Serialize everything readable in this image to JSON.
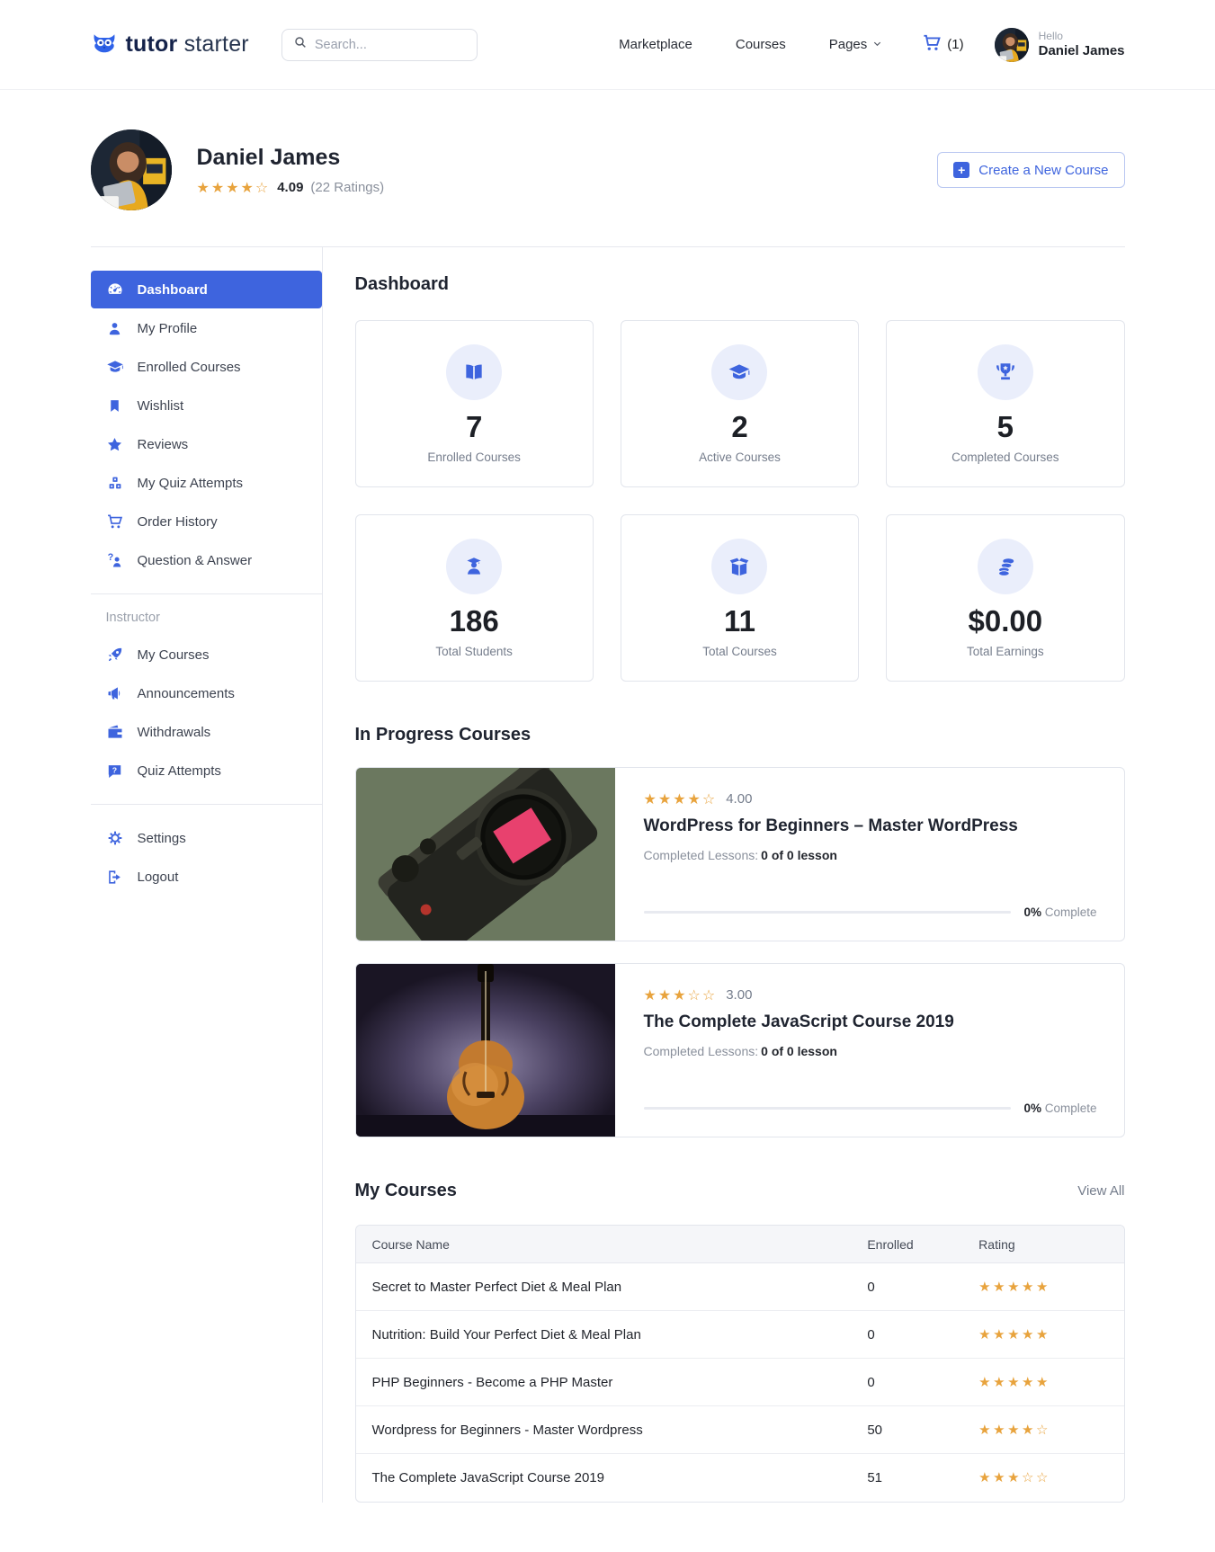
{
  "brand": {
    "logo_bold": "tutor",
    "logo_light": "starter",
    "logo_icon": "owl-icon"
  },
  "navbar": {
    "search_placeholder": "Search...",
    "links": [
      {
        "label": "Marketplace"
      },
      {
        "label": "Courses"
      },
      {
        "label": "Pages"
      }
    ],
    "cart_count": "(1)",
    "greeting": "Hello",
    "user_name": "Daniel James"
  },
  "profile_header": {
    "name": "Daniel James",
    "stars": {
      "filled": 4,
      "total": 5
    },
    "rating_value": "4.09",
    "rating_count": "(22 Ratings)",
    "create_course_label": "Create a New Course"
  },
  "sidebar": {
    "items": [
      {
        "label": "Dashboard",
        "icon": "dashboard-icon",
        "active": true
      },
      {
        "label": "My Profile",
        "icon": "user-icon"
      },
      {
        "label": "Enrolled Courses",
        "icon": "graduation-cap-icon"
      },
      {
        "label": "Wishlist",
        "icon": "bookmark-icon"
      },
      {
        "label": "Reviews",
        "icon": "star-icon"
      },
      {
        "label": "My Quiz Attempts",
        "icon": "blocks-icon"
      },
      {
        "label": "Order History",
        "icon": "cart-icon"
      },
      {
        "label": "Question & Answer",
        "icon": "question-person-icon"
      }
    ],
    "section_label": "Instructor",
    "instructor_items": [
      {
        "label": "My Courses",
        "icon": "rocket-icon"
      },
      {
        "label": "Announcements",
        "icon": "megaphone-icon"
      },
      {
        "label": "Withdrawals",
        "icon": "wallet-icon"
      },
      {
        "label": "Quiz Attempts",
        "icon": "quiz-bubble-icon"
      }
    ],
    "footer_items": [
      {
        "label": "Settings",
        "icon": "gear-icon"
      },
      {
        "label": "Logout",
        "icon": "logout-icon"
      }
    ]
  },
  "dashboard": {
    "title": "Dashboard",
    "stats": [
      {
        "value": "7",
        "label": "Enrolled Courses",
        "icon": "open-book-icon"
      },
      {
        "value": "2",
        "label": "Active Courses",
        "icon": "graduation-cap-icon"
      },
      {
        "value": "5",
        "label": "Completed Courses",
        "icon": "trophy-icon"
      },
      {
        "value": "186",
        "label": "Total Students",
        "icon": "student-icon"
      },
      {
        "value": "11",
        "label": "Total Courses",
        "icon": "box-icon"
      },
      {
        "value": "$0.00",
        "label": "Total Earnings",
        "icon": "coins-icon"
      }
    ]
  },
  "in_progress": {
    "title": "In Progress Courses",
    "courses": [
      {
        "stars": {
          "filled": 4,
          "total": 5
        },
        "rating": "4.00",
        "title": "WordPress for Beginners – Master WordPress",
        "lessons_label": "Completed Lessons:",
        "lessons_value": "0 of 0 lesson",
        "percent": "0%",
        "percent_label": "Complete",
        "image": "camera-photo"
      },
      {
        "stars": {
          "filled": 3,
          "total": 5
        },
        "rating": "3.00",
        "title": "The Complete JavaScript Course 2019",
        "lessons_label": "Completed Lessons:",
        "lessons_value": "0 of 0 lesson",
        "percent": "0%",
        "percent_label": "Complete",
        "image": "guitar-photo"
      }
    ]
  },
  "my_courses": {
    "title": "My Courses",
    "view_all": "View All",
    "columns": [
      "Course Name",
      "Enrolled",
      "Rating"
    ],
    "rows": [
      {
        "name": "Secret to Master Perfect Diet & Meal Plan",
        "enrolled": "0",
        "stars": {
          "filled": 5,
          "total": 5
        }
      },
      {
        "name": "Nutrition: Build Your Perfect Diet & Meal Plan",
        "enrolled": "0",
        "stars": {
          "filled": 5,
          "total": 5
        }
      },
      {
        "name": "PHP Beginners - Become a PHP Master",
        "enrolled": "0",
        "stars": {
          "filled": 5,
          "total": 5
        }
      },
      {
        "name": "Wordpress for Beginners - Master Wordpress",
        "enrolled": "50",
        "stars": {
          "filled": 4,
          "total": 5
        }
      },
      {
        "name": "The Complete JavaScript Course 2019",
        "enrolled": "51",
        "stars": {
          "filled": 3,
          "total": 5
        }
      }
    ]
  },
  "colors": {
    "primary": "#3E64DE",
    "star": "#E8A33D",
    "icon_circle_bg": "#EAEEFB"
  }
}
